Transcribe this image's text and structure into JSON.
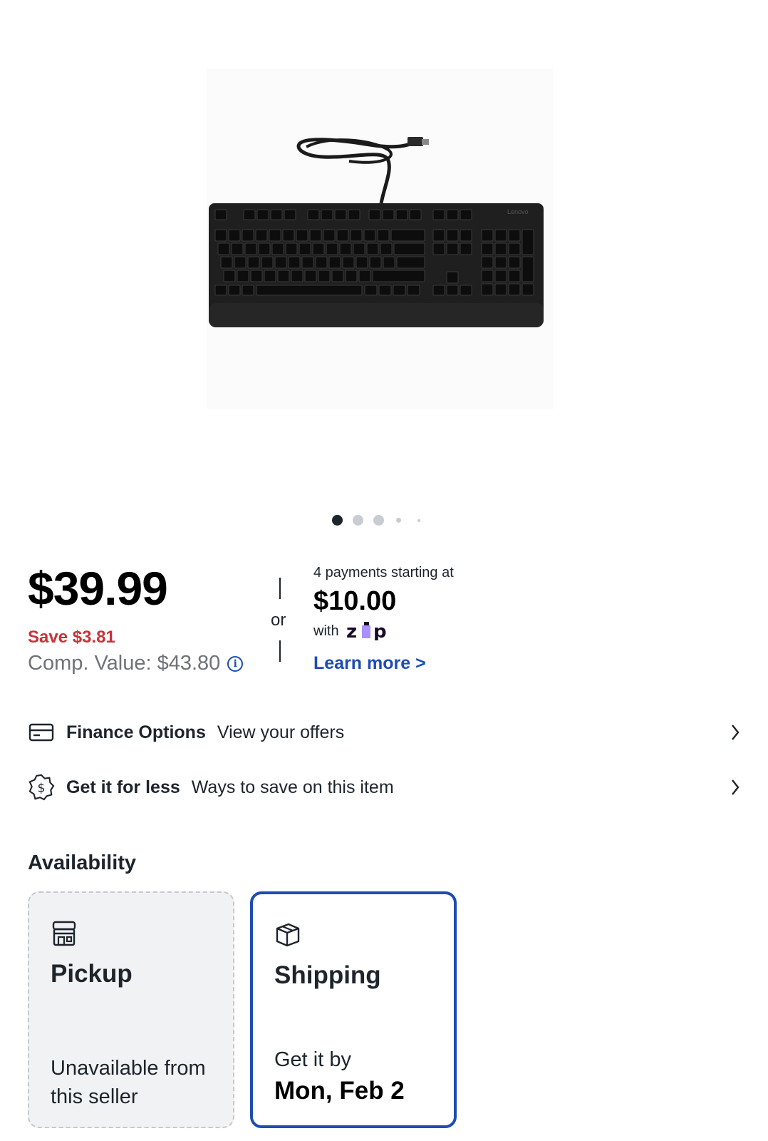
{
  "product": {
    "image_alt": "Lenovo wired USB keyboard",
    "brand_on_image": "Lenovo",
    "carousel": {
      "total": 5,
      "active": 1
    }
  },
  "pricing": {
    "price": "$39.99",
    "save": "Save $3.81",
    "comp_value": "Comp. Value: $43.80",
    "info_icon": "i",
    "or": "or"
  },
  "zip": {
    "payments_text": "4 payments starting at",
    "amount": "$10.00",
    "with": "with",
    "logo_text": "zip",
    "learn_more": "Learn more >"
  },
  "rows": [
    {
      "icon": "credit-card-icon",
      "title": "Finance Options",
      "subtitle": "View your offers"
    },
    {
      "icon": "dollar-badge-icon",
      "title": "Get it for less",
      "subtitle": "Ways to save on this item"
    }
  ],
  "availability": {
    "heading": "Availability",
    "pickup": {
      "icon": "store-icon",
      "title": "Pickup",
      "desc": "Unavailable from this seller"
    },
    "shipping": {
      "icon": "package-icon",
      "title": "Shipping",
      "desc": "Get it by",
      "date": "Mon, Feb 2"
    }
  },
  "colors": {
    "accent_blue": "#1d4cb5",
    "save_red": "#c8323a",
    "zip_purple": "#aa8fff"
  }
}
